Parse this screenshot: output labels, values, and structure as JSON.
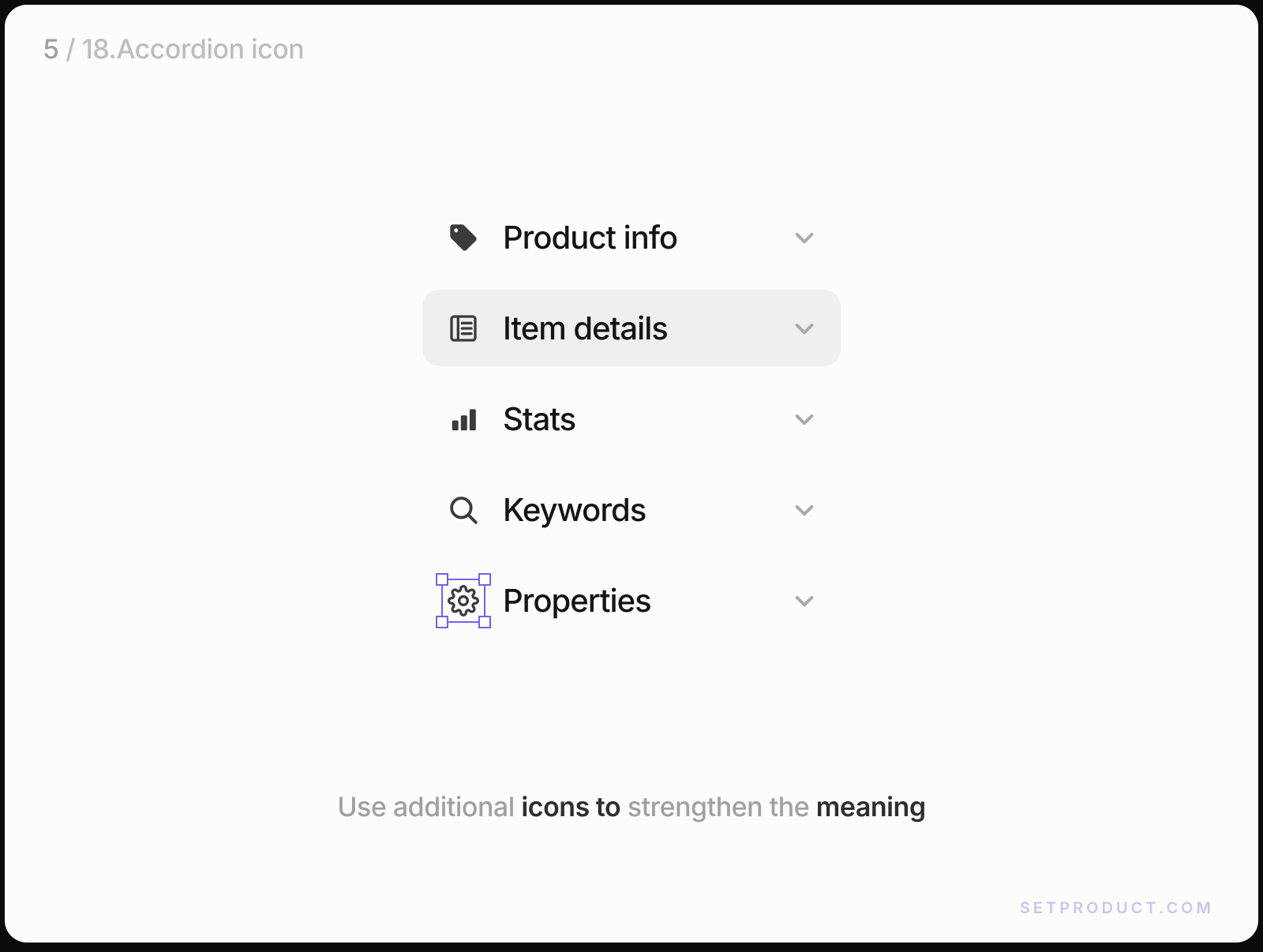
{
  "breadcrumb": {
    "index": "5",
    "total": "18",
    "title": "Accordion icon"
  },
  "accordion": {
    "items": [
      {
        "icon": "tag-icon",
        "label": "Product info",
        "hover": false,
        "selected": false
      },
      {
        "icon": "document-icon",
        "label": "Item details",
        "hover": true,
        "selected": false
      },
      {
        "icon": "bars-icon",
        "label": "Stats",
        "hover": false,
        "selected": false
      },
      {
        "icon": "search-icon",
        "label": "Keywords",
        "hover": false,
        "selected": false
      },
      {
        "icon": "gear-icon",
        "label": "Properties",
        "hover": false,
        "selected": true
      }
    ]
  },
  "caption": {
    "pre": "Use additional ",
    "bold1": "icons to",
    "mid": " strengthen the ",
    "bold2": "meaning"
  },
  "watermark": "SETPRODUCT.COM",
  "colors": {
    "accent": "#6e63f2",
    "row_hover": "#efeff0"
  }
}
